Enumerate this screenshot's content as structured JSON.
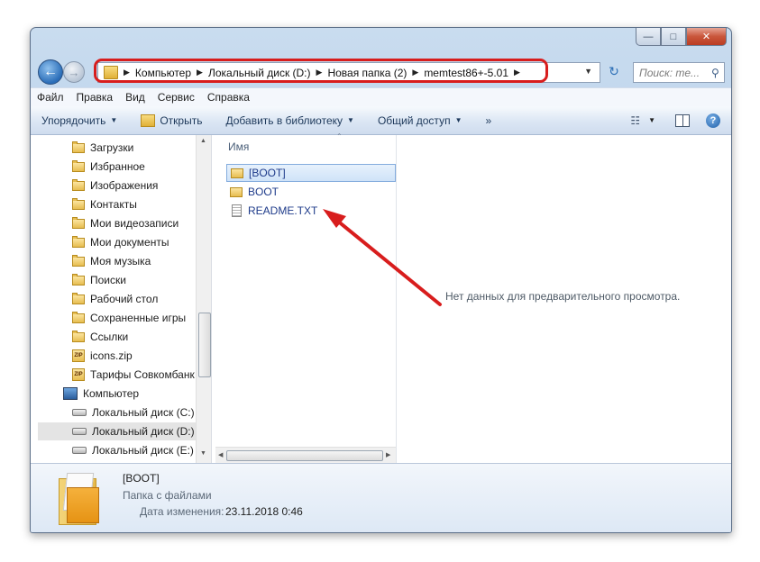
{
  "address_bar": {
    "breadcrumbs": [
      "Компьютер",
      "Локальный диск (D:)",
      "Новая папка (2)",
      "memtest86+-5.01"
    ]
  },
  "search": {
    "placeholder": "Поиск: me..."
  },
  "menu": [
    "Файл",
    "Правка",
    "Вид",
    "Сервис",
    "Справка"
  ],
  "toolbar": {
    "organize": "Упорядочить",
    "open": "Открыть",
    "add_to_library": "Добавить в библиотеку",
    "share": "Общий доступ",
    "more": "»"
  },
  "nav_tree": [
    {
      "label": "Загрузки",
      "icon": "folder-icon"
    },
    {
      "label": "Избранное",
      "icon": "folder-icon"
    },
    {
      "label": "Изображения",
      "icon": "folder-icon"
    },
    {
      "label": "Контакты",
      "icon": "folder-icon"
    },
    {
      "label": "Мои видеозаписи",
      "icon": "folder-icon"
    },
    {
      "label": "Мои документы",
      "icon": "folder-icon"
    },
    {
      "label": "Моя музыка",
      "icon": "folder-icon"
    },
    {
      "label": "Поиски",
      "icon": "folder-icon"
    },
    {
      "label": "Рабочий стол",
      "icon": "folder-icon"
    },
    {
      "label": "Сохраненные игры",
      "icon": "folder-icon"
    },
    {
      "label": "Ссылки",
      "icon": "folder-icon"
    },
    {
      "label": "icons.zip",
      "icon": "zip-icon"
    },
    {
      "label": "Тарифы Совкомбанк",
      "icon": "zip-icon"
    },
    {
      "label": "Компьютер",
      "icon": "computer-icon"
    },
    {
      "label": "Локальный диск (C:)",
      "icon": "drive-icon"
    },
    {
      "label": "Локальный диск (D:)",
      "icon": "drive-icon",
      "selected": true
    },
    {
      "label": "Локальный диск (E:)",
      "icon": "drive-icon"
    }
  ],
  "file_list": {
    "column_name": "Имя",
    "items": [
      {
        "name": "[BOOT]",
        "type": "folder",
        "selected": true
      },
      {
        "name": "BOOT",
        "type": "folder"
      },
      {
        "name": "README.TXT",
        "type": "text"
      }
    ]
  },
  "preview": {
    "message": "Нет данных для предварительного просмотра."
  },
  "details": {
    "name": "[BOOT]",
    "type": "Папка с файлами",
    "date_label": "Дата изменения:",
    "date_value": "23.11.2018 0:46"
  },
  "colors": {
    "highlight_red": "#d81d1d",
    "link_blue": "#1e3b8a"
  }
}
